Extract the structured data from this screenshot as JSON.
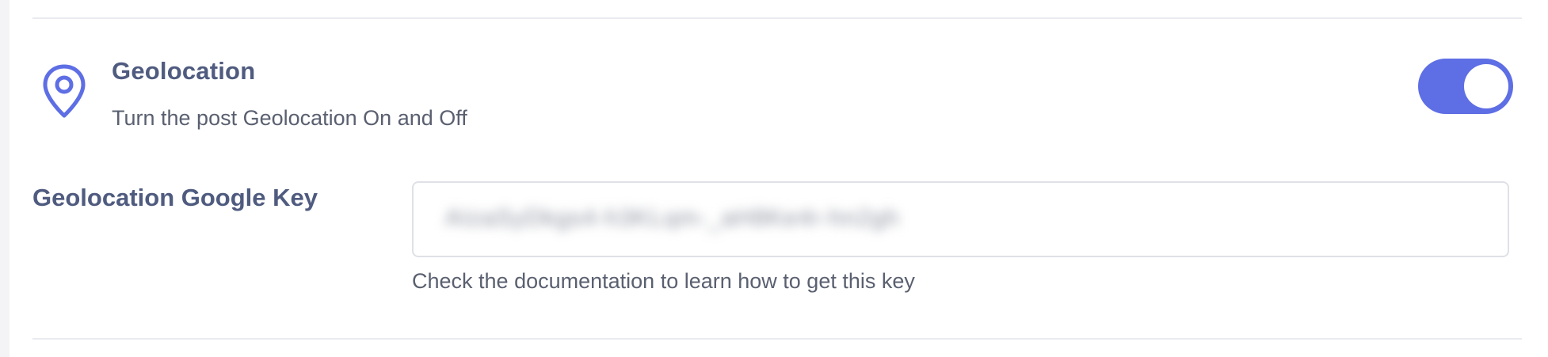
{
  "geolocation": {
    "icon": "map-pin-icon",
    "title": "Geolocation",
    "description": "Turn the post Geolocation On and Off",
    "enabled": true,
    "accent_color": "#5e6ee4"
  },
  "google_key": {
    "label": "Geolocation Google Key",
    "value": "AIzaSyDkgs4-h3KLqm-_aH8Ke4r-hn2gh",
    "help_text": "Check the documentation to learn how to get this key"
  }
}
